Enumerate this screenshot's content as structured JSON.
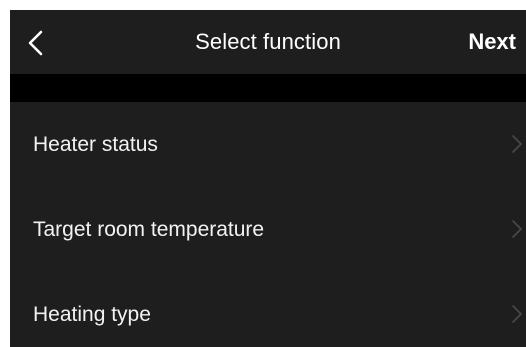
{
  "nav": {
    "back_icon": "chevron-left-icon",
    "title": "Select function",
    "next_label": "Next"
  },
  "functions": {
    "items": [
      {
        "label": "Heater status",
        "icon": "chevron-right-icon"
      },
      {
        "label": "Target room temperature",
        "icon": "chevron-right-icon"
      },
      {
        "label": "Heating type",
        "icon": "chevron-right-icon"
      }
    ]
  },
  "colors": {
    "background": "#1e1e1e",
    "divider_band": "#000000",
    "text": "#ffffff",
    "chevron": "#4a4a4a"
  }
}
